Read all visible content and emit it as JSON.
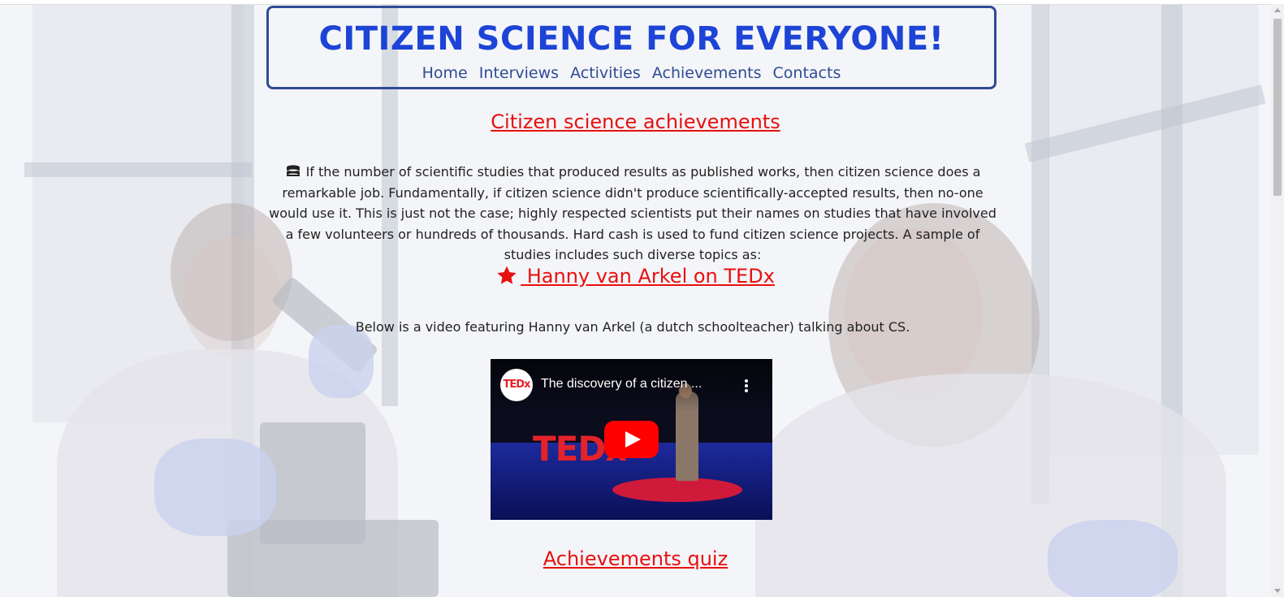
{
  "header": {
    "title": "CITIZEN SCIENCE FOR EVERYONE!",
    "nav": [
      "Home",
      "Interviews",
      "Activities",
      "Achievements",
      "Contacts"
    ]
  },
  "main": {
    "section_heading": "Citizen science achievements",
    "intro_icon": "coins-icon",
    "intro_text": "If the number of scientific studies that produced results as published works, then citizen science does a remarkable job. Fundamentally, if citizen science didn't produce scientifically-accepted results, then no-one would use it. This is just not the case; highly respected scientists put their names on studies that have involved a few volunteers or hundreds of thousands. Hard cash is used to fund citizen science projects. A sample of studies includes such diverse topics as:",
    "video_heading_icon": "star-icon",
    "video_heading": " Hanny van Arkel on TEDx",
    "video_caption": "Below is a video featuring Hanny van Arkel (a dutch schoolteacher) talking about CS.",
    "video": {
      "channel_logo": "TEDx",
      "title": "The discovery of a citizen ...",
      "stage_text": "TEDx"
    },
    "quiz_heading": "Achievements quiz"
  },
  "colors": {
    "title_blue": "#1d44d6",
    "nav_blue": "#2f4b94",
    "heading_red": "#e8100f"
  }
}
